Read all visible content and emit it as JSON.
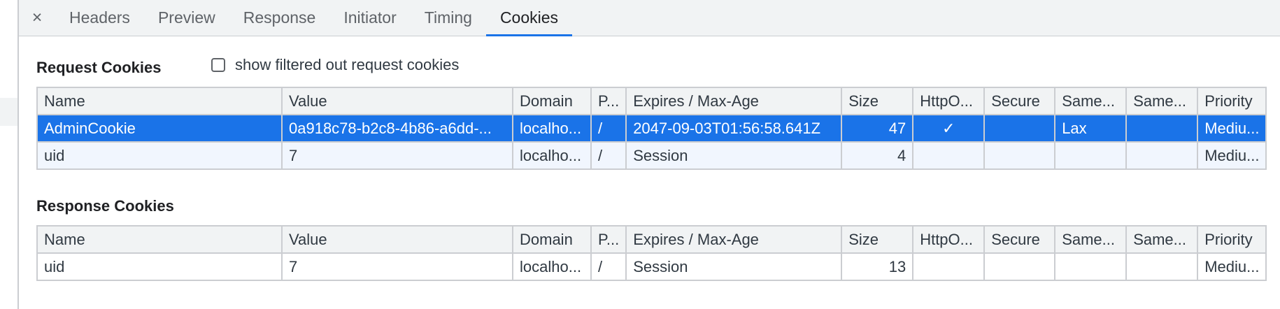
{
  "tabs": {
    "close_icon": "×",
    "items": [
      "Headers",
      "Preview",
      "Response",
      "Initiator",
      "Timing",
      "Cookies"
    ],
    "selected": "Cookies"
  },
  "request": {
    "title": "Request Cookies",
    "filter_label": "show filtered out request cookies",
    "columns": [
      "Name",
      "Value",
      "Domain",
      "P...",
      "Expires / Max-Age",
      "Size",
      "HttpO...",
      "Secure",
      "Same...",
      "Same...",
      "Priority"
    ],
    "rows": [
      {
        "name": "AdminCookie",
        "value": "0a918c78-b2c8-4b86-a6dd-...",
        "domain": "localho...",
        "path": "/",
        "expires": "2047-09-03T01:56:58.641Z",
        "size": "47",
        "httponly": "✓",
        "secure": "",
        "samesite": "Lax",
        "sameparty": "",
        "priority": "Mediu..."
      },
      {
        "name": "uid",
        "value": "7",
        "domain": "localho...",
        "path": "/",
        "expires": "Session",
        "size": "4",
        "httponly": "",
        "secure": "",
        "samesite": "",
        "sameparty": "",
        "priority": "Mediu..."
      }
    ]
  },
  "response": {
    "title": "Response Cookies",
    "columns": [
      "Name",
      "Value",
      "Domain",
      "P...",
      "Expires / Max-Age",
      "Size",
      "HttpO...",
      "Secure",
      "Same...",
      "Same...",
      "Priority"
    ],
    "rows": [
      {
        "name": "uid",
        "value": "7",
        "domain": "localho...",
        "path": "/",
        "expires": "Session",
        "size": "13",
        "httponly": "",
        "secure": "",
        "samesite": "",
        "sameparty": "",
        "priority": "Mediu..."
      }
    ]
  },
  "colors": {
    "accent": "#1a73e8",
    "selected_row": "#1a73e8",
    "striped_row": "#f1f6fe",
    "header_bg": "#f1f3f4"
  }
}
